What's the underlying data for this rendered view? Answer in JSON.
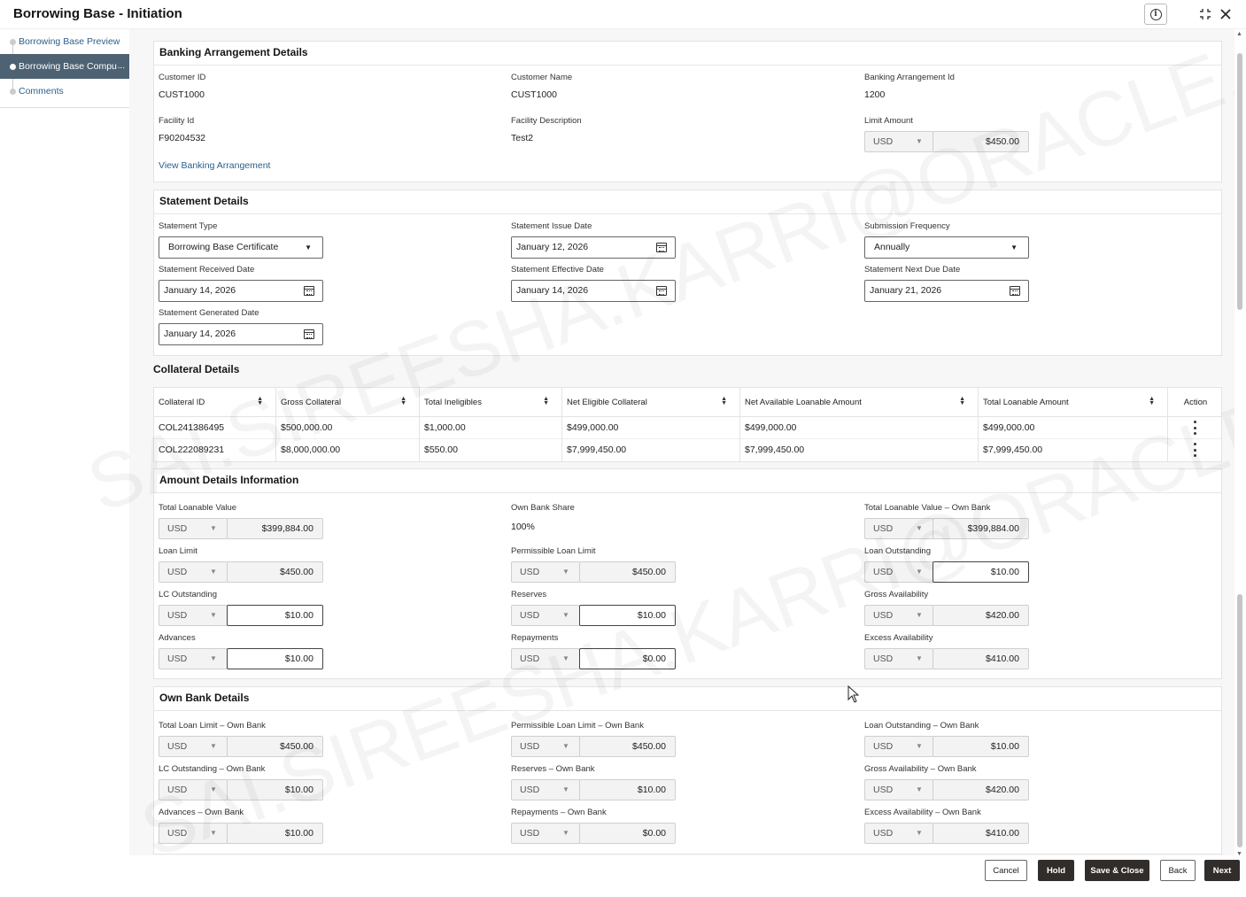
{
  "header": {
    "title": "Borrowing Base - Initiation",
    "info_icon": "info-icon",
    "minimize_icon": "compress-icon",
    "close_icon": "close-icon"
  },
  "sidebar": {
    "items": [
      {
        "label": "Borrowing Base Preview",
        "active": false
      },
      {
        "label": "Borrowing Base Compu",
        "active": true
      },
      {
        "label": "Comments",
        "active": false
      }
    ],
    "ellipsis": "..."
  },
  "banking": {
    "title": "Banking Arrangement Details",
    "customer_id_label": "Customer ID",
    "customer_id": "CUST1000",
    "customer_name_label": "Customer Name",
    "customer_name": "CUST1000",
    "arrangement_id_label": "Banking Arrangement Id",
    "arrangement_id": "1200",
    "facility_id_label": "Facility Id",
    "facility_id": "F90204532",
    "facility_desc_label": "Facility Description",
    "facility_desc": "Test2",
    "limit_amount_label": "Limit Amount",
    "limit_ccy": "USD",
    "limit_amount": "$450.00",
    "view_link": "View Banking Arrangement"
  },
  "statement": {
    "title": "Statement Details",
    "type_label": "Statement Type",
    "type_value": "Borrowing Base Certificate",
    "issue_label": "Statement Issue Date",
    "issue_value": "January 12, 2026",
    "frequency_label": "Submission Frequency",
    "frequency_value": "Annually",
    "received_label": "Statement Received Date",
    "received_value": "January 14, 2026",
    "effective_label": "Statement Effective Date",
    "effective_value": "January 14, 2026",
    "next_due_label": "Statement Next Due Date",
    "next_due_value": "January 21, 2026",
    "generated_label": "Statement Generated Date",
    "generated_value": "January 14, 2026"
  },
  "collateral": {
    "title": "Collateral Details",
    "columns": [
      "Collateral ID",
      "Gross Collateral",
      "Total Ineligibles",
      "Net Eligible Collateral",
      "Net Available Loanable Amount",
      "Total Loanable Amount",
      "Action"
    ],
    "rows": [
      [
        "COL241386495",
        "$500,000.00",
        "$1,000.00",
        "$499,000.00",
        "$499,000.00",
        "$499,000.00"
      ],
      [
        "COL222089231",
        "$8,000,000.00",
        "$550.00",
        "$7,999,450.00",
        "$7,999,450.00",
        "$7,999,450.00"
      ]
    ]
  },
  "amount": {
    "title": "Amount Details Information",
    "fields": [
      {
        "label": "Total Loanable Value",
        "ccy": "USD",
        "value": "$399,884.00",
        "editable": false
      },
      {
        "label": "Own Bank Share",
        "text": "100%"
      },
      {
        "label": "Total Loanable Value – Own Bank",
        "ccy": "USD",
        "value": "$399,884.00",
        "editable": false
      },
      {
        "label": "Loan Limit",
        "ccy": "USD",
        "value": "$450.00",
        "editable": false
      },
      {
        "label": "Permissible Loan Limit",
        "ccy": "USD",
        "value": "$450.00",
        "editable": false
      },
      {
        "label": "Loan Outstanding",
        "ccy": "USD",
        "value": "$10.00",
        "editable": true
      },
      {
        "label": "LC Outstanding",
        "ccy": "USD",
        "value": "$10.00",
        "editable": true
      },
      {
        "label": "Reserves",
        "ccy": "USD",
        "value": "$10.00",
        "editable": true
      },
      {
        "label": "Gross Availability",
        "ccy": "USD",
        "value": "$420.00",
        "editable": false
      },
      {
        "label": "Advances",
        "ccy": "USD",
        "value": "$10.00",
        "editable": true
      },
      {
        "label": "Repayments",
        "ccy": "USD",
        "value": "$0.00",
        "editable": true
      },
      {
        "label": "Excess Availability",
        "ccy": "USD",
        "value": "$410.00",
        "editable": false
      }
    ]
  },
  "ownbank": {
    "title": "Own Bank Details",
    "fields": [
      {
        "label": "Total Loan Limit – Own Bank",
        "ccy": "USD",
        "value": "$450.00"
      },
      {
        "label": "Permissible Loan Limit – Own Bank",
        "ccy": "USD",
        "value": "$450.00"
      },
      {
        "label": "Loan Outstanding – Own Bank",
        "ccy": "USD",
        "value": "$10.00"
      },
      {
        "label": "LC Outstanding – Own Bank",
        "ccy": "USD",
        "value": "$10.00"
      },
      {
        "label": "Reserves – Own Bank",
        "ccy": "USD",
        "value": "$10.00"
      },
      {
        "label": "Gross Availability – Own Bank",
        "ccy": "USD",
        "value": "$420.00"
      },
      {
        "label": "Advances – Own Bank",
        "ccy": "USD",
        "value": "$10.00"
      },
      {
        "label": "Repayments – Own Bank",
        "ccy": "USD",
        "value": "$0.00"
      },
      {
        "label": "Excess Availability – Own Bank",
        "ccy": "USD",
        "value": "$410.00"
      }
    ]
  },
  "footer": {
    "cancel": "Cancel",
    "hold": "Hold",
    "save_close": "Save & Close",
    "back": "Back",
    "next": "Next"
  },
  "watermark": {
    "line1": "SAI.SIREESHA.KARRI@ORACLE.COM",
    "line2": "SAI.SIREESHA.KARRI@ORACLE.COM"
  }
}
